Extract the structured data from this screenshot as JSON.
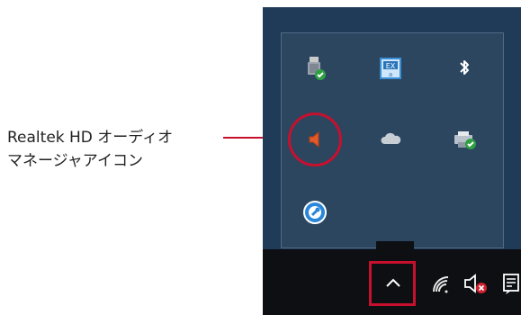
{
  "callout": {
    "line1": "Realtek HD オーディオ",
    "line2": "マネージャアイコン"
  },
  "tray": {
    "icons": [
      "usb-device-check-icon",
      "dictionary-app-icon",
      "bluetooth-icon",
      "speaker-realtek-icon",
      "onedrive-cloud-icon",
      "printer-check-icon",
      "key-wrench-utility-icon"
    ]
  },
  "taskbar": {
    "icons": [
      "show-hidden-icons-chevron-icon",
      "wifi-icon",
      "volume-muted-icon",
      "action-center-icon"
    ]
  },
  "colors": {
    "accent_red": "#c8102e",
    "desktop_bg": "#1f3b57",
    "taskbar_bg": "#0d0f12"
  }
}
